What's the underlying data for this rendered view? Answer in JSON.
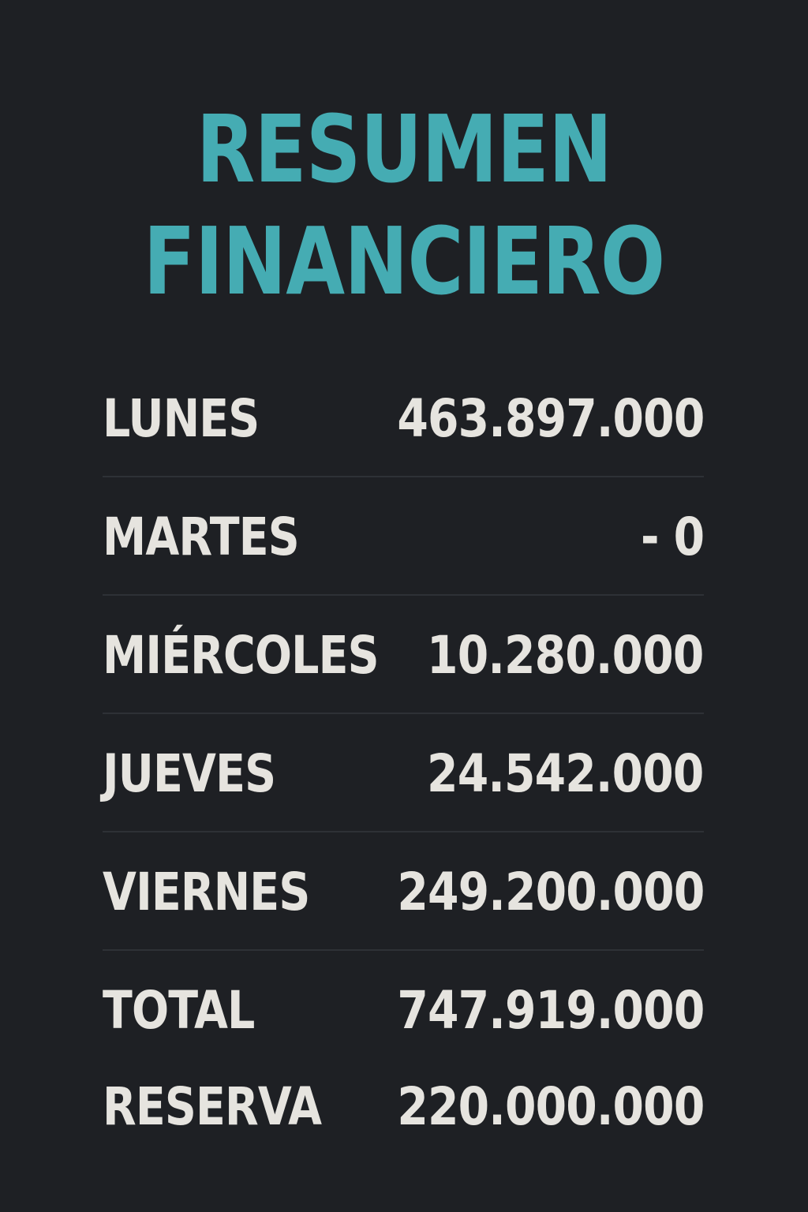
{
  "header": {
    "title_line1": "RESUMEN",
    "title_line2": "FINANCIERO"
  },
  "colors": {
    "background": "#1e2024",
    "title": "#45acb3",
    "text": "#e6e4df",
    "divider": "#2e3136"
  },
  "rows": [
    {
      "label": "LUNES",
      "value": "463.897.000"
    },
    {
      "label": "MARTES",
      "value": "- 0"
    },
    {
      "label": "MIÉRCOLES",
      "value": "10.280.000"
    },
    {
      "label": "JUEVES",
      "value": "24.542.000"
    },
    {
      "label": "VIERNES",
      "value": "249.200.000"
    },
    {
      "label": "TOTAL",
      "value": "747.919.000"
    },
    {
      "label": "RESERVA",
      "value": "220.000.000"
    }
  ]
}
